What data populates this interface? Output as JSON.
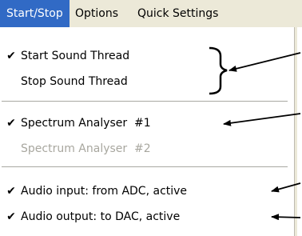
{
  "menubar": {
    "items": [
      {
        "label": "Start/Stop"
      },
      {
        "label": "Options"
      },
      {
        "label": "Quick Settings"
      }
    ]
  },
  "menu": {
    "items": [
      {
        "label": "Start Sound Thread",
        "checked": true
      },
      {
        "label": "Stop Sound Thread",
        "checked": false
      },
      {
        "label": "Spectrum Analyser  #1",
        "checked": true
      },
      {
        "label": "Spectrum Analyser  #2",
        "checked": false,
        "disabled": true
      },
      {
        "label": "Audio input: from ADC, active",
        "checked": true
      },
      {
        "label": "Audio output: to DAC, active",
        "checked": true
      }
    ],
    "check_glyph": "✔"
  },
  "colors": {
    "menubar_bg": "#ece9d8",
    "highlight": "#316ac5",
    "disabled_text": "#a8a79f"
  }
}
